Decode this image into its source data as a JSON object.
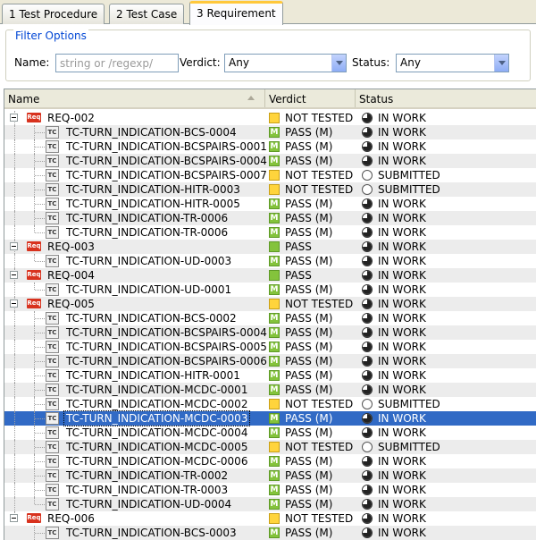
{
  "tabs": [
    {
      "label": "1 Test Procedure",
      "active": false
    },
    {
      "label": "2 Test Case",
      "active": false
    },
    {
      "label": "3 Requirement",
      "active": true
    }
  ],
  "filter": {
    "legend": "Filter Options",
    "name_label": "Name:",
    "name_placeholder": "string or /regexp/",
    "verdict_label": "Verdict:",
    "verdict_value": "Any",
    "status_label": "Status:",
    "status_value": "Any"
  },
  "columns": {
    "name": "Name",
    "verdict": "Verdict",
    "status": "Status"
  },
  "icons": {
    "requirement": "Req",
    "testcase": "TC"
  },
  "colors": {
    "pass": "#84c33c",
    "not_tested": "#ffd43c",
    "selection": "#316ac5",
    "req_icon": "#d8321e"
  },
  "rows": [
    {
      "type": "req",
      "name": "REQ-002",
      "verdict": "NOT TESTED",
      "vicon": "nt",
      "status": "IN WORK",
      "sicon": "work"
    },
    {
      "type": "tc",
      "name": "TC-TURN_INDICATION-BCS-0004",
      "verdict": "PASS (M)",
      "vicon": "pass-m",
      "status": "IN WORK",
      "sicon": "work"
    },
    {
      "type": "tc",
      "name": "TC-TURN_INDICATION-BCSPAIRS-0001",
      "verdict": "PASS (M)",
      "vicon": "pass-m",
      "status": "IN WORK",
      "sicon": "work"
    },
    {
      "type": "tc",
      "name": "TC-TURN_INDICATION-BCSPAIRS-0004",
      "verdict": "PASS (M)",
      "vicon": "pass-m",
      "status": "IN WORK",
      "sicon": "work"
    },
    {
      "type": "tc",
      "name": "TC-TURN_INDICATION-BCSPAIRS-0007",
      "verdict": "NOT TESTED",
      "vicon": "nt",
      "status": "SUBMITTED",
      "sicon": "submitted"
    },
    {
      "type": "tc",
      "name": "TC-TURN_INDICATION-HITR-0003",
      "verdict": "NOT TESTED",
      "vicon": "nt",
      "status": "SUBMITTED",
      "sicon": "submitted"
    },
    {
      "type": "tc",
      "name": "TC-TURN_INDICATION-HITR-0005",
      "verdict": "PASS (M)",
      "vicon": "pass-m",
      "status": "IN WORK",
      "sicon": "work"
    },
    {
      "type": "tc",
      "name": "TC-TURN_INDICATION-TR-0006",
      "verdict": "PASS (M)",
      "vicon": "pass-m",
      "status": "IN WORK",
      "sicon": "work"
    },
    {
      "type": "tc",
      "name": "TC-TURN_INDICATION-TR-0006",
      "verdict": "PASS (M)",
      "vicon": "pass-m",
      "status": "IN WORK",
      "sicon": "work"
    },
    {
      "type": "req",
      "name": "REQ-003",
      "verdict": "PASS",
      "vicon": "pass",
      "status": "IN WORK",
      "sicon": "work"
    },
    {
      "type": "tc",
      "name": "TC-TURN_INDICATION-UD-0003",
      "verdict": "PASS (M)",
      "vicon": "pass-m",
      "status": "IN WORK",
      "sicon": "work"
    },
    {
      "type": "req",
      "name": "REQ-004",
      "verdict": "PASS",
      "vicon": "pass",
      "status": "IN WORK",
      "sicon": "work"
    },
    {
      "type": "tc",
      "name": "TC-TURN_INDICATION-UD-0001",
      "verdict": "PASS (M)",
      "vicon": "pass-m",
      "status": "IN WORK",
      "sicon": "work"
    },
    {
      "type": "req",
      "name": "REQ-005",
      "verdict": "NOT TESTED",
      "vicon": "nt",
      "status": "IN WORK",
      "sicon": "work"
    },
    {
      "type": "tc",
      "name": "TC-TURN_INDICATION-BCS-0002",
      "verdict": "PASS (M)",
      "vicon": "pass-m",
      "status": "IN WORK",
      "sicon": "work"
    },
    {
      "type": "tc",
      "name": "TC-TURN_INDICATION-BCSPAIRS-0004",
      "verdict": "PASS (M)",
      "vicon": "pass-m",
      "status": "IN WORK",
      "sicon": "work"
    },
    {
      "type": "tc",
      "name": "TC-TURN_INDICATION-BCSPAIRS-0005",
      "verdict": "PASS (M)",
      "vicon": "pass-m",
      "status": "IN WORK",
      "sicon": "work"
    },
    {
      "type": "tc",
      "name": "TC-TURN_INDICATION-BCSPAIRS-0006",
      "verdict": "PASS (M)",
      "vicon": "pass-m",
      "status": "IN WORK",
      "sicon": "work"
    },
    {
      "type": "tc",
      "name": "TC-TURN_INDICATION-HITR-0001",
      "verdict": "PASS (M)",
      "vicon": "pass-m",
      "status": "IN WORK",
      "sicon": "work"
    },
    {
      "type": "tc",
      "name": "TC-TURN_INDICATION-MCDC-0001",
      "verdict": "PASS (M)",
      "vicon": "pass-m",
      "status": "IN WORK",
      "sicon": "work"
    },
    {
      "type": "tc",
      "name": "TC-TURN_INDICATION-MCDC-0002",
      "verdict": "NOT TESTED",
      "vicon": "nt",
      "status": "SUBMITTED",
      "sicon": "submitted"
    },
    {
      "type": "tc",
      "name": "TC-TURN_INDICATION-MCDC-0003",
      "verdict": "PASS (M)",
      "vicon": "pass-m",
      "status": "IN WORK",
      "sicon": "work",
      "selected": true
    },
    {
      "type": "tc",
      "name": "TC-TURN_INDICATION-MCDC-0004",
      "verdict": "PASS (M)",
      "vicon": "pass-m",
      "status": "IN WORK",
      "sicon": "work"
    },
    {
      "type": "tc",
      "name": "TC-TURN_INDICATION-MCDC-0005",
      "verdict": "NOT TESTED",
      "vicon": "nt",
      "status": "SUBMITTED",
      "sicon": "submitted"
    },
    {
      "type": "tc",
      "name": "TC-TURN_INDICATION-MCDC-0006",
      "verdict": "PASS (M)",
      "vicon": "pass-m",
      "status": "IN WORK",
      "sicon": "work"
    },
    {
      "type": "tc",
      "name": "TC-TURN_INDICATION-TR-0002",
      "verdict": "PASS (M)",
      "vicon": "pass-m",
      "status": "IN WORK",
      "sicon": "work"
    },
    {
      "type": "tc",
      "name": "TC-TURN_INDICATION-TR-0003",
      "verdict": "PASS (M)",
      "vicon": "pass-m",
      "status": "IN WORK",
      "sicon": "work"
    },
    {
      "type": "tc",
      "name": "TC-TURN_INDICATION-UD-0004",
      "verdict": "PASS (M)",
      "vicon": "pass-m",
      "status": "IN WORK",
      "sicon": "work"
    },
    {
      "type": "req",
      "name": "REQ-006",
      "verdict": "NOT TESTED",
      "vicon": "nt",
      "status": "IN WORK",
      "sicon": "work"
    },
    {
      "type": "tc",
      "name": "TC-TURN_INDICATION-BCS-0003",
      "verdict": "PASS (M)",
      "vicon": "pass-m",
      "status": "IN WORK",
      "sicon": "work"
    }
  ]
}
